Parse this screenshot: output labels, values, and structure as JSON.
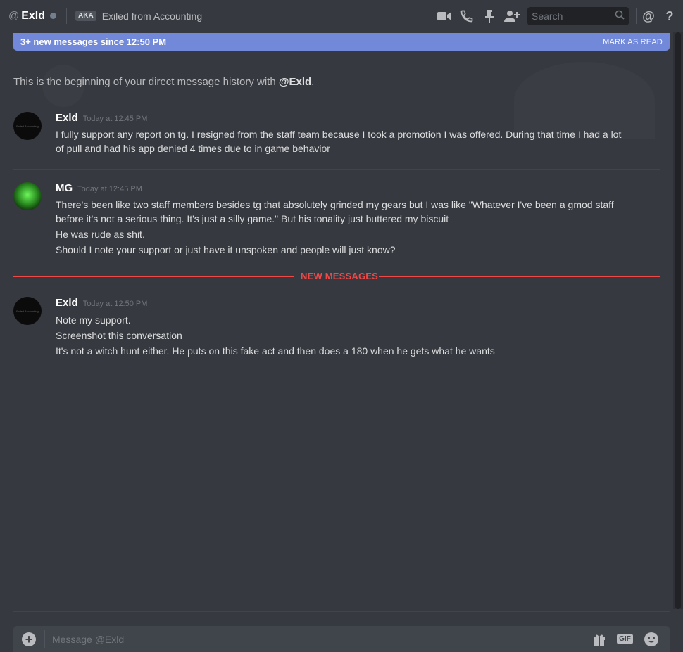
{
  "header": {
    "at_symbol": "@",
    "username": "Exld",
    "aka_badge": "AKA",
    "nickname": "Exiled from Accounting",
    "search_placeholder": "Search",
    "icons": [
      "video-call-icon",
      "voice-call-icon",
      "pin-icon",
      "add-friend-icon",
      "search-icon",
      "mention-icon",
      "help-icon"
    ]
  },
  "banner": {
    "text": "3+ new messages since 12:50 PM",
    "mark_read": "MARK AS READ"
  },
  "welcome": {
    "prefix": "This is the beginning of your direct message history with ",
    "handle": "@Exld",
    "suffix": "."
  },
  "messages": [
    {
      "author": "Exld",
      "timestamp": "Today at 12:45 PM",
      "lines": [
        "I fully support any report on tg. I resigned from the staff team because I took a promotion I was offered. During that time I had a lot",
        "of pull and had his app denied 4 times due to in game behavior"
      ]
    },
    {
      "author": "MG",
      "timestamp": "Today at 12:45 PM",
      "lines": [
        "There's been like two staff members besides tg that absolutely grinded my gears but I was like \"Whatever I've been a gmod staff",
        "before it's not a serious thing. It's just a silly game.\" But his tonality just buttered my biscuit",
        "He was rude as shit.",
        "Should I note your support or just have it unspoken and people will just know?"
      ]
    },
    {
      "author": "Exld",
      "timestamp": "Today at 12:50 PM",
      "lines": [
        "Note my support.",
        "Screenshot this conversation",
        "It's not a witch hunt either. He puts on this fake act and then does a 180 when he gets what he wants"
      ]
    }
  ],
  "new_messages_label": "NEW MESSAGES",
  "avatar_text": "Exiled Accounting",
  "composer": {
    "placeholder": "Message @Exld",
    "gif_label": "GIF",
    "icons": [
      "add-attachment-icon",
      "gift-icon",
      "gif-icon",
      "emoji-icon"
    ]
  },
  "colors": {
    "background": "#36393f",
    "accent": "#7289da",
    "new_messages": "#f04747"
  }
}
